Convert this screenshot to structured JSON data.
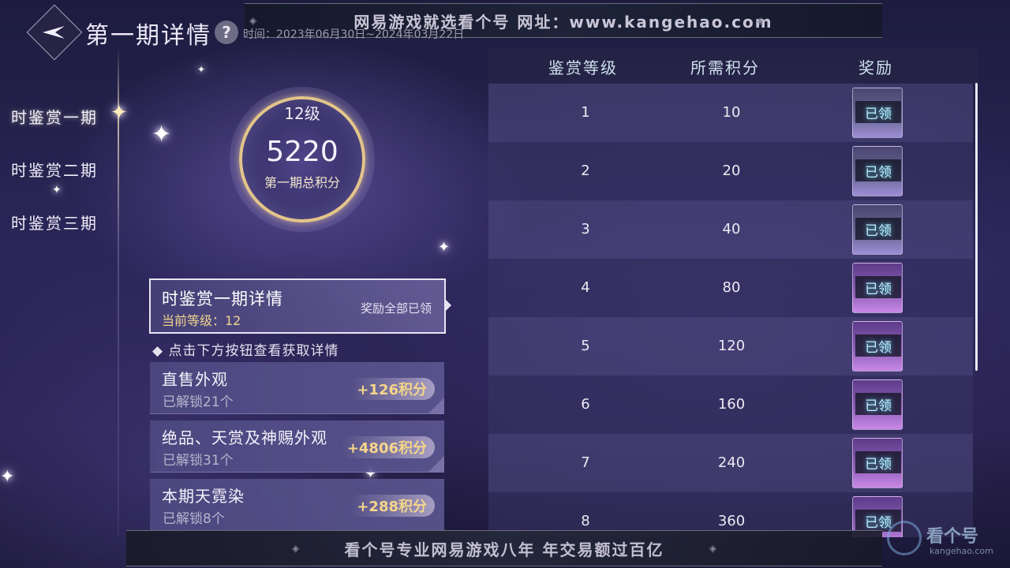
{
  "header": {
    "title": "第一期详情",
    "help_icon": "?",
    "time": "时间：2023年06月30日~2024年03月22日"
  },
  "banners": {
    "top": "网易游戏就选看个号  网址：www.kangehao.com",
    "bottom": "看个号专业网易游戏八年  年交易额过百亿"
  },
  "sidebar": {
    "items": [
      {
        "label": "时鉴赏一期"
      },
      {
        "label": "时鉴赏二期"
      },
      {
        "label": "时鉴赏三期"
      }
    ]
  },
  "score": {
    "level": "12级",
    "total": "5220",
    "label": "第一期总积分"
  },
  "detail_card": {
    "title": "时鉴赏一期详情",
    "current_level": "当前等级：12",
    "status": "奖励全部已领"
  },
  "tip": "◆ 点击下方按钮查看获取详情",
  "sources": [
    {
      "title": "直售外观",
      "unlocked": "已解锁21个",
      "points": "+126积分"
    },
    {
      "title": "绝品、天赏及神赐外观",
      "unlocked": "已解锁31个",
      "points": "+4806积分"
    },
    {
      "title": "本期天霓染",
      "unlocked": "已解锁8个",
      "points": "+288积分"
    }
  ],
  "table": {
    "headers": [
      "鉴赏等级",
      "所需积分",
      "奖励"
    ],
    "rows": [
      {
        "level": "1",
        "points": "10",
        "reward": "已领"
      },
      {
        "level": "2",
        "points": "20",
        "reward": "已领"
      },
      {
        "level": "3",
        "points": "40",
        "reward": "已领"
      },
      {
        "level": "4",
        "points": "80",
        "reward": "已领"
      },
      {
        "level": "5",
        "points": "120",
        "reward": "已领"
      },
      {
        "level": "6",
        "points": "160",
        "reward": "已领"
      },
      {
        "level": "7",
        "points": "240",
        "reward": "已领"
      },
      {
        "level": "8",
        "points": "360",
        "reward": "已领"
      }
    ]
  },
  "watermark": {
    "text": "看个号",
    "sub": "kangehao.com"
  }
}
